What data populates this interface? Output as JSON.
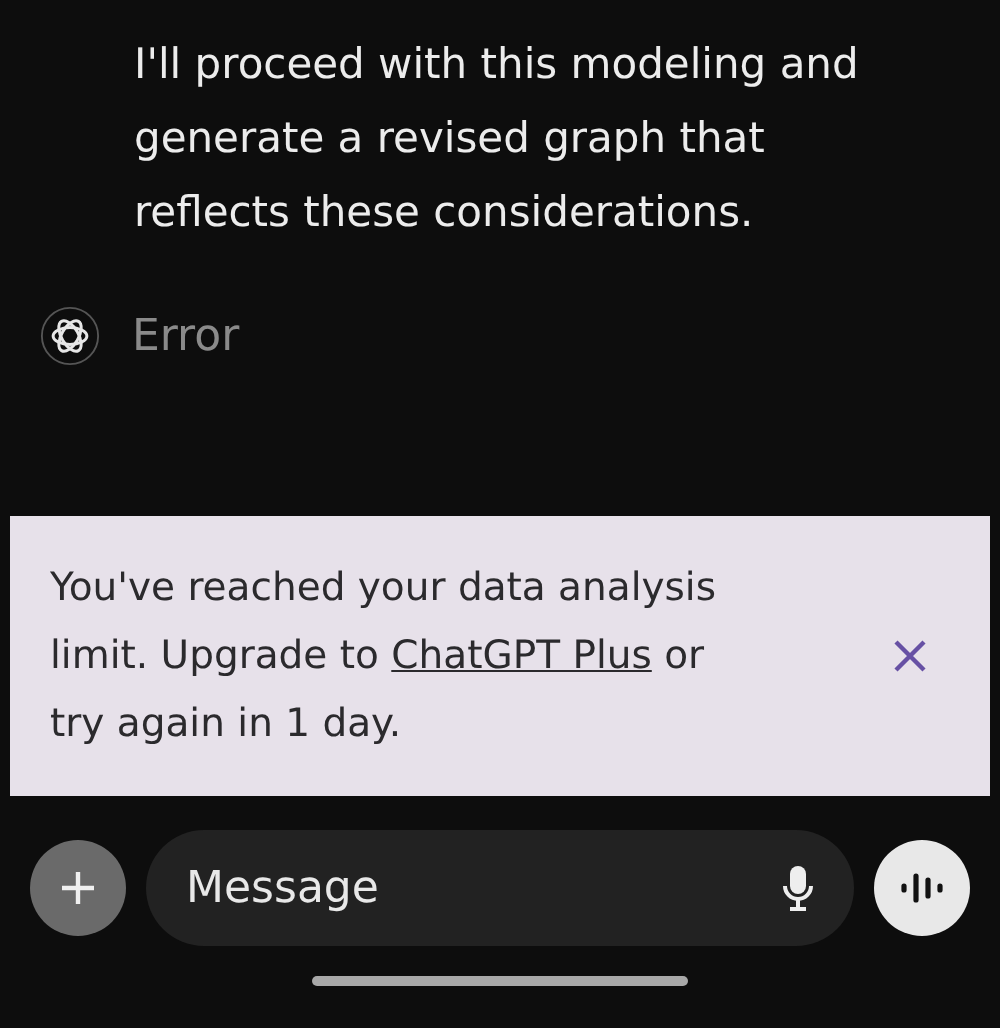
{
  "message": {
    "text": "I'll proceed with this modeling and generate a revised graph that reflects these considerations."
  },
  "error": {
    "text": "Error"
  },
  "banner": {
    "text_before": "You've reached your data analysis limit. Upgrade to ",
    "link": "ChatGPT Plus",
    "text_after": " or try again in 1 day."
  },
  "composer": {
    "placeholder": "Message"
  }
}
